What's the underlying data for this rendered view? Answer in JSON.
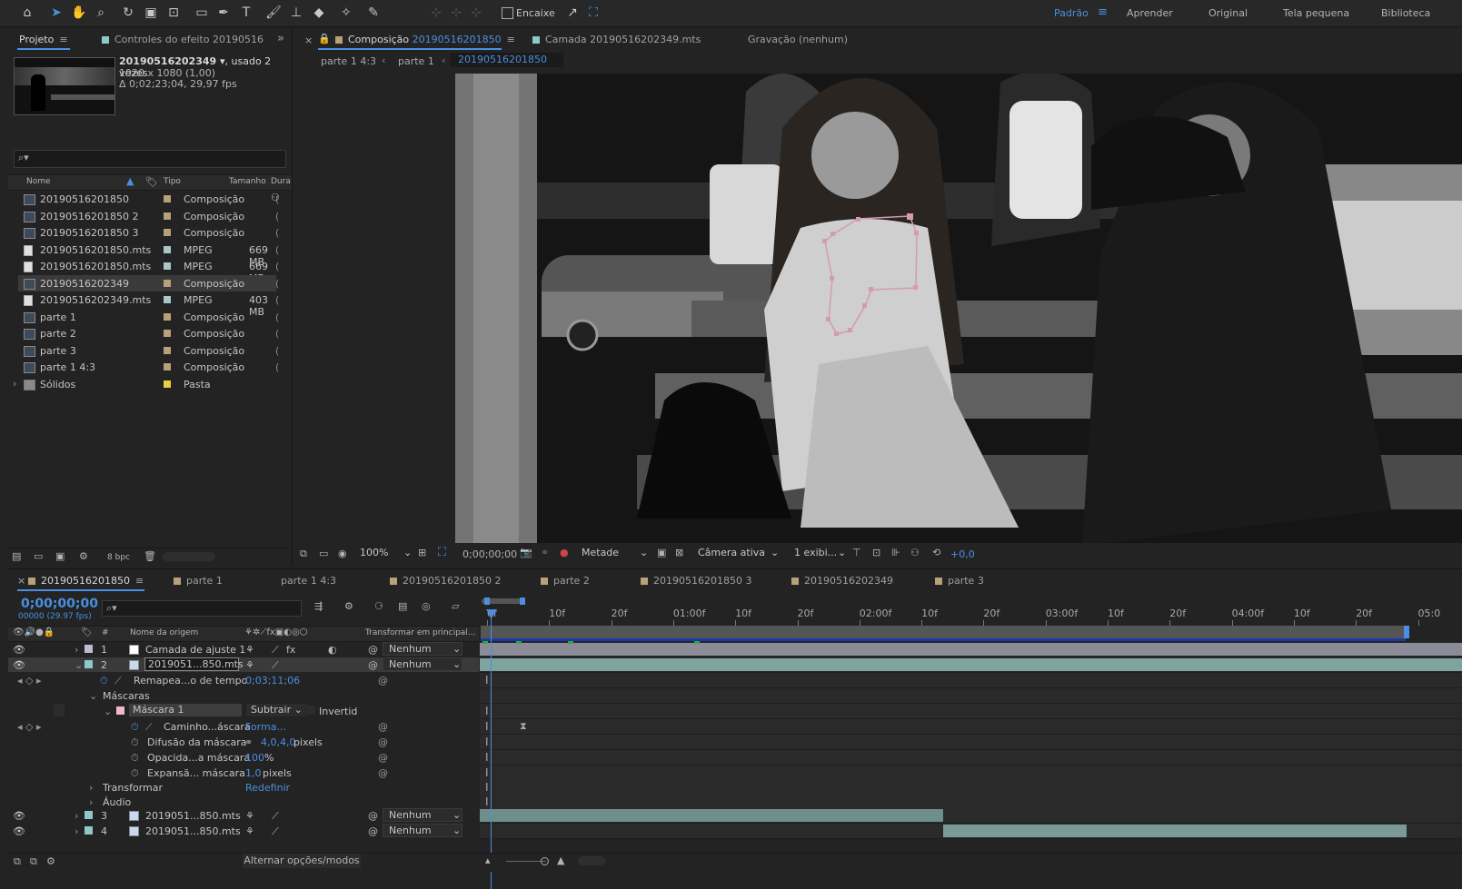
{
  "toolbar": {
    "tools": [
      "home-icon",
      "selection-icon",
      "hand-icon",
      "zoom-icon",
      "rotate-icon",
      "camera-icon",
      "pan-behind-icon",
      "rectangle-icon",
      "pen-icon",
      "type-icon",
      "brush-icon",
      "stamp-icon",
      "eraser-icon",
      "roto-icon",
      "puppet-icon"
    ],
    "snapping_label": "Encaixe",
    "workspaces": [
      "Padrão",
      "Aprender",
      "Original",
      "Tela pequena",
      "Biblioteca"
    ],
    "active_workspace": "Padrão"
  },
  "project_panel": {
    "tab_label": "Projeto",
    "effect_controls_tab": "Controles do efeito",
    "effect_controls_target": "20190516202349.mts",
    "selected_item": {
      "name": "20190516202349",
      "usage": ", usado 2 vezes",
      "dims": "1920 x 1080 (1,00)",
      "duration": "Δ 0;02;23;04, 29,97 fps"
    },
    "search_placeholder": "",
    "columns": {
      "name": "Nome",
      "type": "Tipo",
      "size": "Tamanho",
      "duration": "Dura"
    },
    "items": [
      {
        "name": "20190516201850",
        "type": "Composição",
        "size": "",
        "kind": "comp",
        "color": "#b8a07a"
      },
      {
        "name": "20190516201850 2",
        "type": "Composição",
        "size": "",
        "kind": "comp",
        "color": "#b8a07a"
      },
      {
        "name": "20190516201850 3",
        "type": "Composição",
        "size": "",
        "kind": "comp",
        "color": "#b8a07a"
      },
      {
        "name": "20190516201850.mts",
        "type": "MPEG",
        "size": "669 MB",
        "kind": "file",
        "color": "#a8c8c8"
      },
      {
        "name": "20190516201850.mts",
        "type": "MPEG",
        "size": "669 MB",
        "kind": "file",
        "color": "#a8c8c8"
      },
      {
        "name": "20190516202349",
        "type": "Composição",
        "size": "",
        "kind": "comp",
        "color": "#b8a07a"
      },
      {
        "name": "20190516202349.mts",
        "type": "MPEG",
        "size": "403 MB",
        "kind": "file",
        "color": "#a8c8c8"
      },
      {
        "name": "parte 1",
        "type": "Composição",
        "size": "",
        "kind": "comp",
        "color": "#b8a07a"
      },
      {
        "name": "parte 2",
        "type": "Composição",
        "size": "",
        "kind": "comp",
        "color": "#b8a07a"
      },
      {
        "name": "parte 3",
        "type": "Composição",
        "size": "",
        "kind": "comp",
        "color": "#b8a07a"
      },
      {
        "name": "parte 1 4:3",
        "type": "Composição",
        "size": "",
        "kind": "comp",
        "color": "#b8a07a"
      },
      {
        "name": "Sólidos",
        "type": "Pasta",
        "size": "",
        "kind": "folder",
        "color": "#e8d040"
      }
    ],
    "bpc": "8 bpc"
  },
  "composition_panel": {
    "tab_prefix": "Composição",
    "comp_name": "20190516201850",
    "layer_tab": "Camada 20190516202349.mts",
    "recording": "Gravação (nenhum)",
    "breadcrumbs": [
      "parte 1 4:3",
      "parte 1",
      "20190516201850"
    ],
    "footer": {
      "zoom": "100%",
      "timecode": "0;00;00;00",
      "resolution": "Metade",
      "camera": "Câmera ativa",
      "views": "1 exibi...",
      "exposure": "+0,0"
    }
  },
  "timeline": {
    "tabs": [
      "20190516201850",
      "parte 1",
      "parte 1 4:3",
      "20190516201850 2",
      "parte 2",
      "20190516201850 3",
      "20190516202349",
      "parte 3"
    ],
    "timecode": "0;00;00;00",
    "fps": "00000 (29.97 fps)",
    "col_source": "Nome da origem",
    "col_transform": "Transformar em principal...",
    "ruler": [
      "0f",
      "10f",
      "20f",
      "01:00f",
      "10f",
      "20f",
      "02:00f",
      "10f",
      "20f",
      "03:00f",
      "10f",
      "20f",
      "04:00f",
      "10f",
      "20f",
      "05:0"
    ],
    "layers": [
      {
        "num": "1",
        "name": "Camada de ajuste 1",
        "parent": "Nenhum"
      },
      {
        "num": "2",
        "name": "2019051...850.mts",
        "parent": "Nenhum"
      },
      {
        "num": "3",
        "name": "2019051...850.mts",
        "parent": "Nenhum"
      },
      {
        "num": "4",
        "name": "2019051...850.mts",
        "parent": "Nenhum"
      }
    ],
    "props": {
      "time_remap": "Remapea...o de tempo",
      "time_remap_val": "0;03;11;06",
      "masks": "Máscaras",
      "mask1": "Máscara 1",
      "mask_mode": "Subtrair",
      "invert": "Invertid",
      "path": "Caminho...áscara",
      "path_val": "Forma...",
      "feather": "Difusão da máscara",
      "feather_val": "4,0,4,0",
      "feather_unit": "pixels",
      "opacity": "Opacida...a máscara",
      "opacity_val": "100",
      "opacity_unit": "%",
      "expansion": "Expansã... máscara",
      "expansion_val": "1,0",
      "expansion_unit": "pixels",
      "transform": "Transformar",
      "reset": "Redefinir",
      "audio": "Áudio"
    },
    "footer_toggle": "Alternar opções/modos"
  }
}
